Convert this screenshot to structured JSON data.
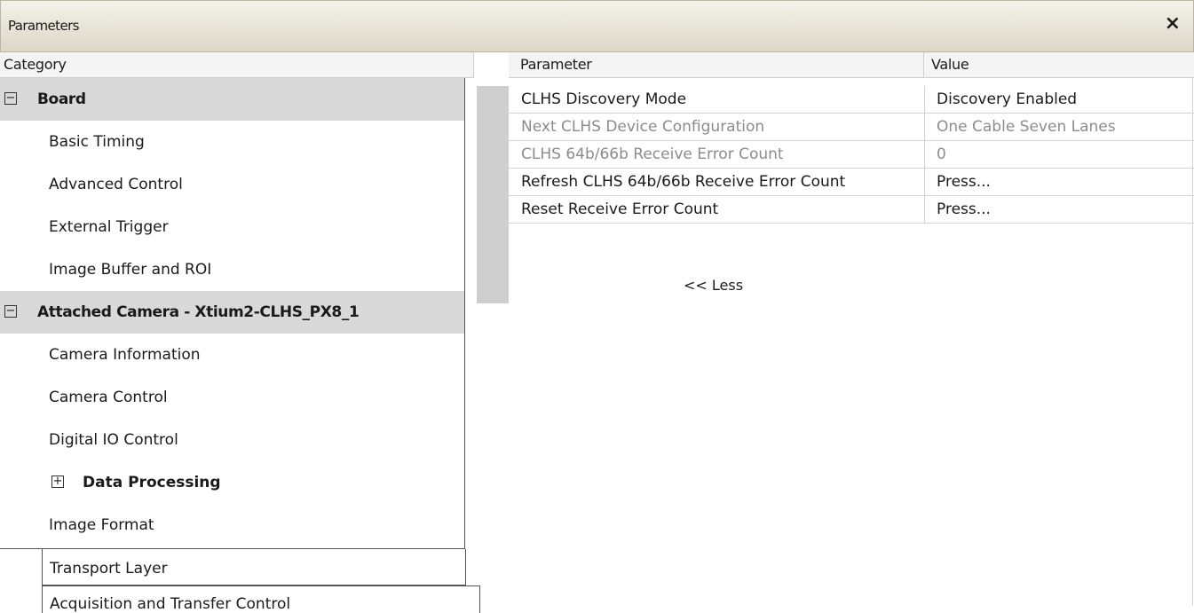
{
  "window": {
    "title": "Parameters",
    "close_glyph": "×"
  },
  "headers": {
    "category": "Category",
    "parameter": "Parameter",
    "value": "Value"
  },
  "categories": [
    {
      "label": "Board",
      "type": "group",
      "toggle": "−"
    },
    {
      "label": "Basic Timing",
      "type": "item"
    },
    {
      "label": "Advanced Control",
      "type": "item"
    },
    {
      "label": "External Trigger",
      "type": "item"
    },
    {
      "label": "Image Buffer and ROI",
      "type": "item"
    },
    {
      "label": "Attached Camera - Xtium2-CLHS_PX8_1",
      "type": "group",
      "toggle": "−"
    },
    {
      "label": "Camera Information",
      "type": "item"
    },
    {
      "label": "Camera Control",
      "type": "item"
    },
    {
      "label": "Digital IO Control",
      "type": "item"
    },
    {
      "label": "Data Processing",
      "type": "subgroup",
      "toggle": "+"
    },
    {
      "label": "Image Format",
      "type": "item"
    },
    {
      "label": "Transport Layer",
      "type": "item",
      "selected": true
    },
    {
      "label": "Acquisition and Transfer Control",
      "type": "item"
    }
  ],
  "parameters": [
    {
      "name": "CLHS Discovery Mode",
      "value": "Discovery Enabled",
      "enabled": true
    },
    {
      "name": "Next CLHS Device Configuration",
      "value": "One Cable Seven Lanes",
      "enabled": false
    },
    {
      "name": "CLHS 64b/66b Receive Error Count",
      "value": "0",
      "enabled": false
    },
    {
      "name": "Refresh CLHS 64b/66b Receive Error Count",
      "value": "Press...",
      "enabled": true
    },
    {
      "name": "Reset Receive Error Count",
      "value": "Press...",
      "enabled": true
    }
  ],
  "less_label": "<< Less"
}
